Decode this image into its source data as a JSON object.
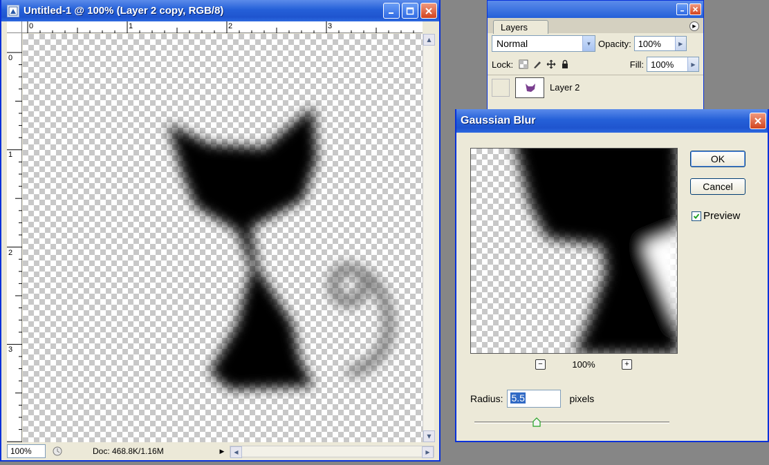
{
  "document_window": {
    "title": "Untitled-1 @ 100% (Layer 2 copy, RGB/8)",
    "ruler_top_labels": [
      "0",
      "1",
      "2",
      "3"
    ],
    "ruler_left_labels": [
      "0",
      "1",
      "2",
      "3"
    ],
    "status": {
      "zoom": "100%",
      "doc_info": "Doc: 468.8K/1.16M"
    }
  },
  "layers_panel": {
    "tab_label": "Layers",
    "blend_mode": "Normal",
    "opacity_label": "Opacity:",
    "opacity_value": "100%",
    "lock_label": "Lock:",
    "fill_label": "Fill:",
    "fill_value": "100%",
    "layer_name": "Layer 2"
  },
  "gaussian_blur": {
    "title": "Gaussian Blur",
    "ok_label": "OK",
    "cancel_label": "Cancel",
    "preview_label": "Preview",
    "preview_checked": true,
    "preview_zoom": "100%",
    "radius_label": "Radius:",
    "radius_value": "5.5",
    "radius_unit": "pixels",
    "slider_fraction": 0.32
  },
  "colors": {
    "titlebar_blue": "#2560d8",
    "close_red": "#d2441e",
    "panel_bg": "#ece9d8",
    "desktop_gray": "#868686"
  }
}
